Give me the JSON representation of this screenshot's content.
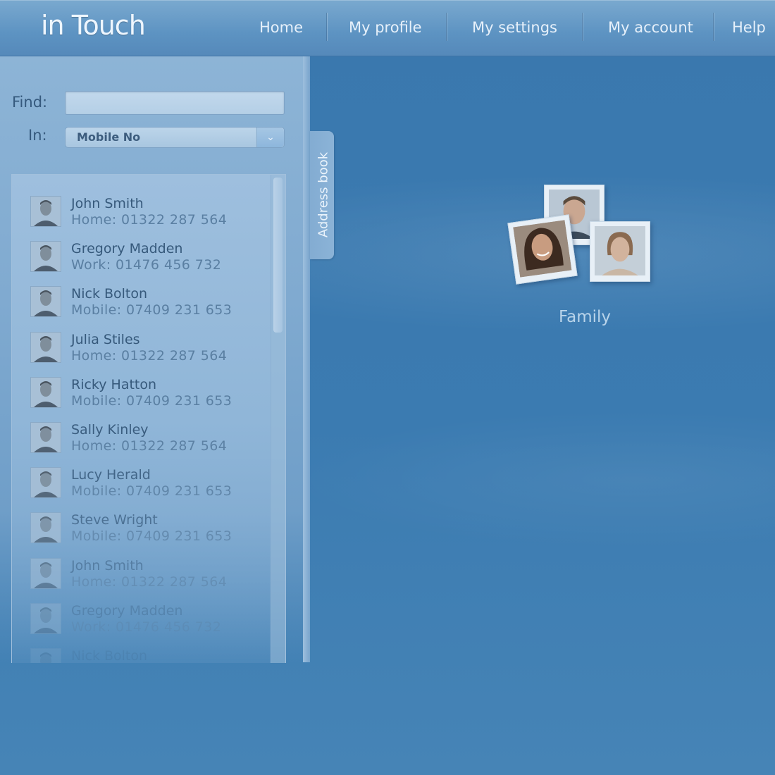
{
  "header": {
    "logo": "in Touch",
    "nav": [
      {
        "label": "Home"
      },
      {
        "label": "My profile"
      },
      {
        "label": "My settings"
      },
      {
        "label": "My account"
      },
      {
        "label": "Help"
      }
    ]
  },
  "search": {
    "find_label": "Find:",
    "find_value": "",
    "in_label": "In:",
    "in_value": "Mobile No"
  },
  "tab": {
    "label": "Address book"
  },
  "contacts": [
    {
      "name": "John Smith",
      "phone": "Home: 01322 287 564"
    },
    {
      "name": "Gregory Madden",
      "phone": "Work: 01476 456 732"
    },
    {
      "name": "Nick Bolton",
      "phone": "Mobile: 07409 231 653"
    },
    {
      "name": "Julia Stiles",
      "phone": "Home: 01322 287 564"
    },
    {
      "name": "Ricky Hatton",
      "phone": "Mobile: 07409 231 653"
    },
    {
      "name": "Sally Kinley",
      "phone": "Home: 01322 287 564"
    },
    {
      "name": "Lucy Herald",
      "phone": "Mobile: 07409 231 653"
    },
    {
      "name": "Steve Wright",
      "phone": "Mobile: 07409 231 653"
    },
    {
      "name": "John Smith",
      "phone": "Home: 01322 287 564"
    },
    {
      "name": "Gregory Madden",
      "phone": "Work: 01476 456 732"
    },
    {
      "name": "Nick Bolton",
      "phone": ""
    }
  ],
  "group": {
    "label": "Family"
  },
  "icons": {
    "dropdown": "chevron-down-icon"
  }
}
